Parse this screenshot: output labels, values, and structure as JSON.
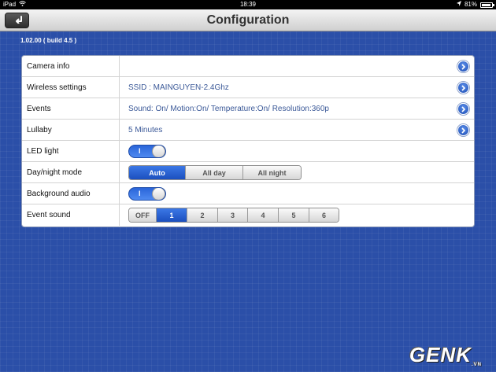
{
  "statusbar": {
    "device": "iPad",
    "time": "18:39",
    "battery": "81%"
  },
  "nav": {
    "title": "Configuration"
  },
  "version": "1.02.00 ( build 4.5 )",
  "rows": [
    {
      "label": "Camera info",
      "value": ""
    },
    {
      "label": "Wireless settings",
      "value": "SSID : MAINGUYEN-2.4Ghz"
    },
    {
      "label": "Events",
      "value": "Sound: On/ Motion:On/ Temperature:On/ Resolution:360p"
    },
    {
      "label": "Lullaby",
      "value": "5 Minutes"
    },
    {
      "label": "LED light",
      "toggle": "I"
    },
    {
      "label": "Day/night mode",
      "options": [
        "Auto",
        "All day",
        "All night"
      ],
      "selected": "Auto"
    },
    {
      "label": "Background audio",
      "toggle": "I"
    },
    {
      "label": "Event sound",
      "options": [
        "OFF",
        "1",
        "2",
        "3",
        "4",
        "5",
        "6"
      ],
      "selected": "1"
    }
  ],
  "watermark": {
    "text": "GENK",
    "suffix": ".VN"
  },
  "colors": {
    "background": "#2b4fa8",
    "accent": "#1b4fbe"
  }
}
